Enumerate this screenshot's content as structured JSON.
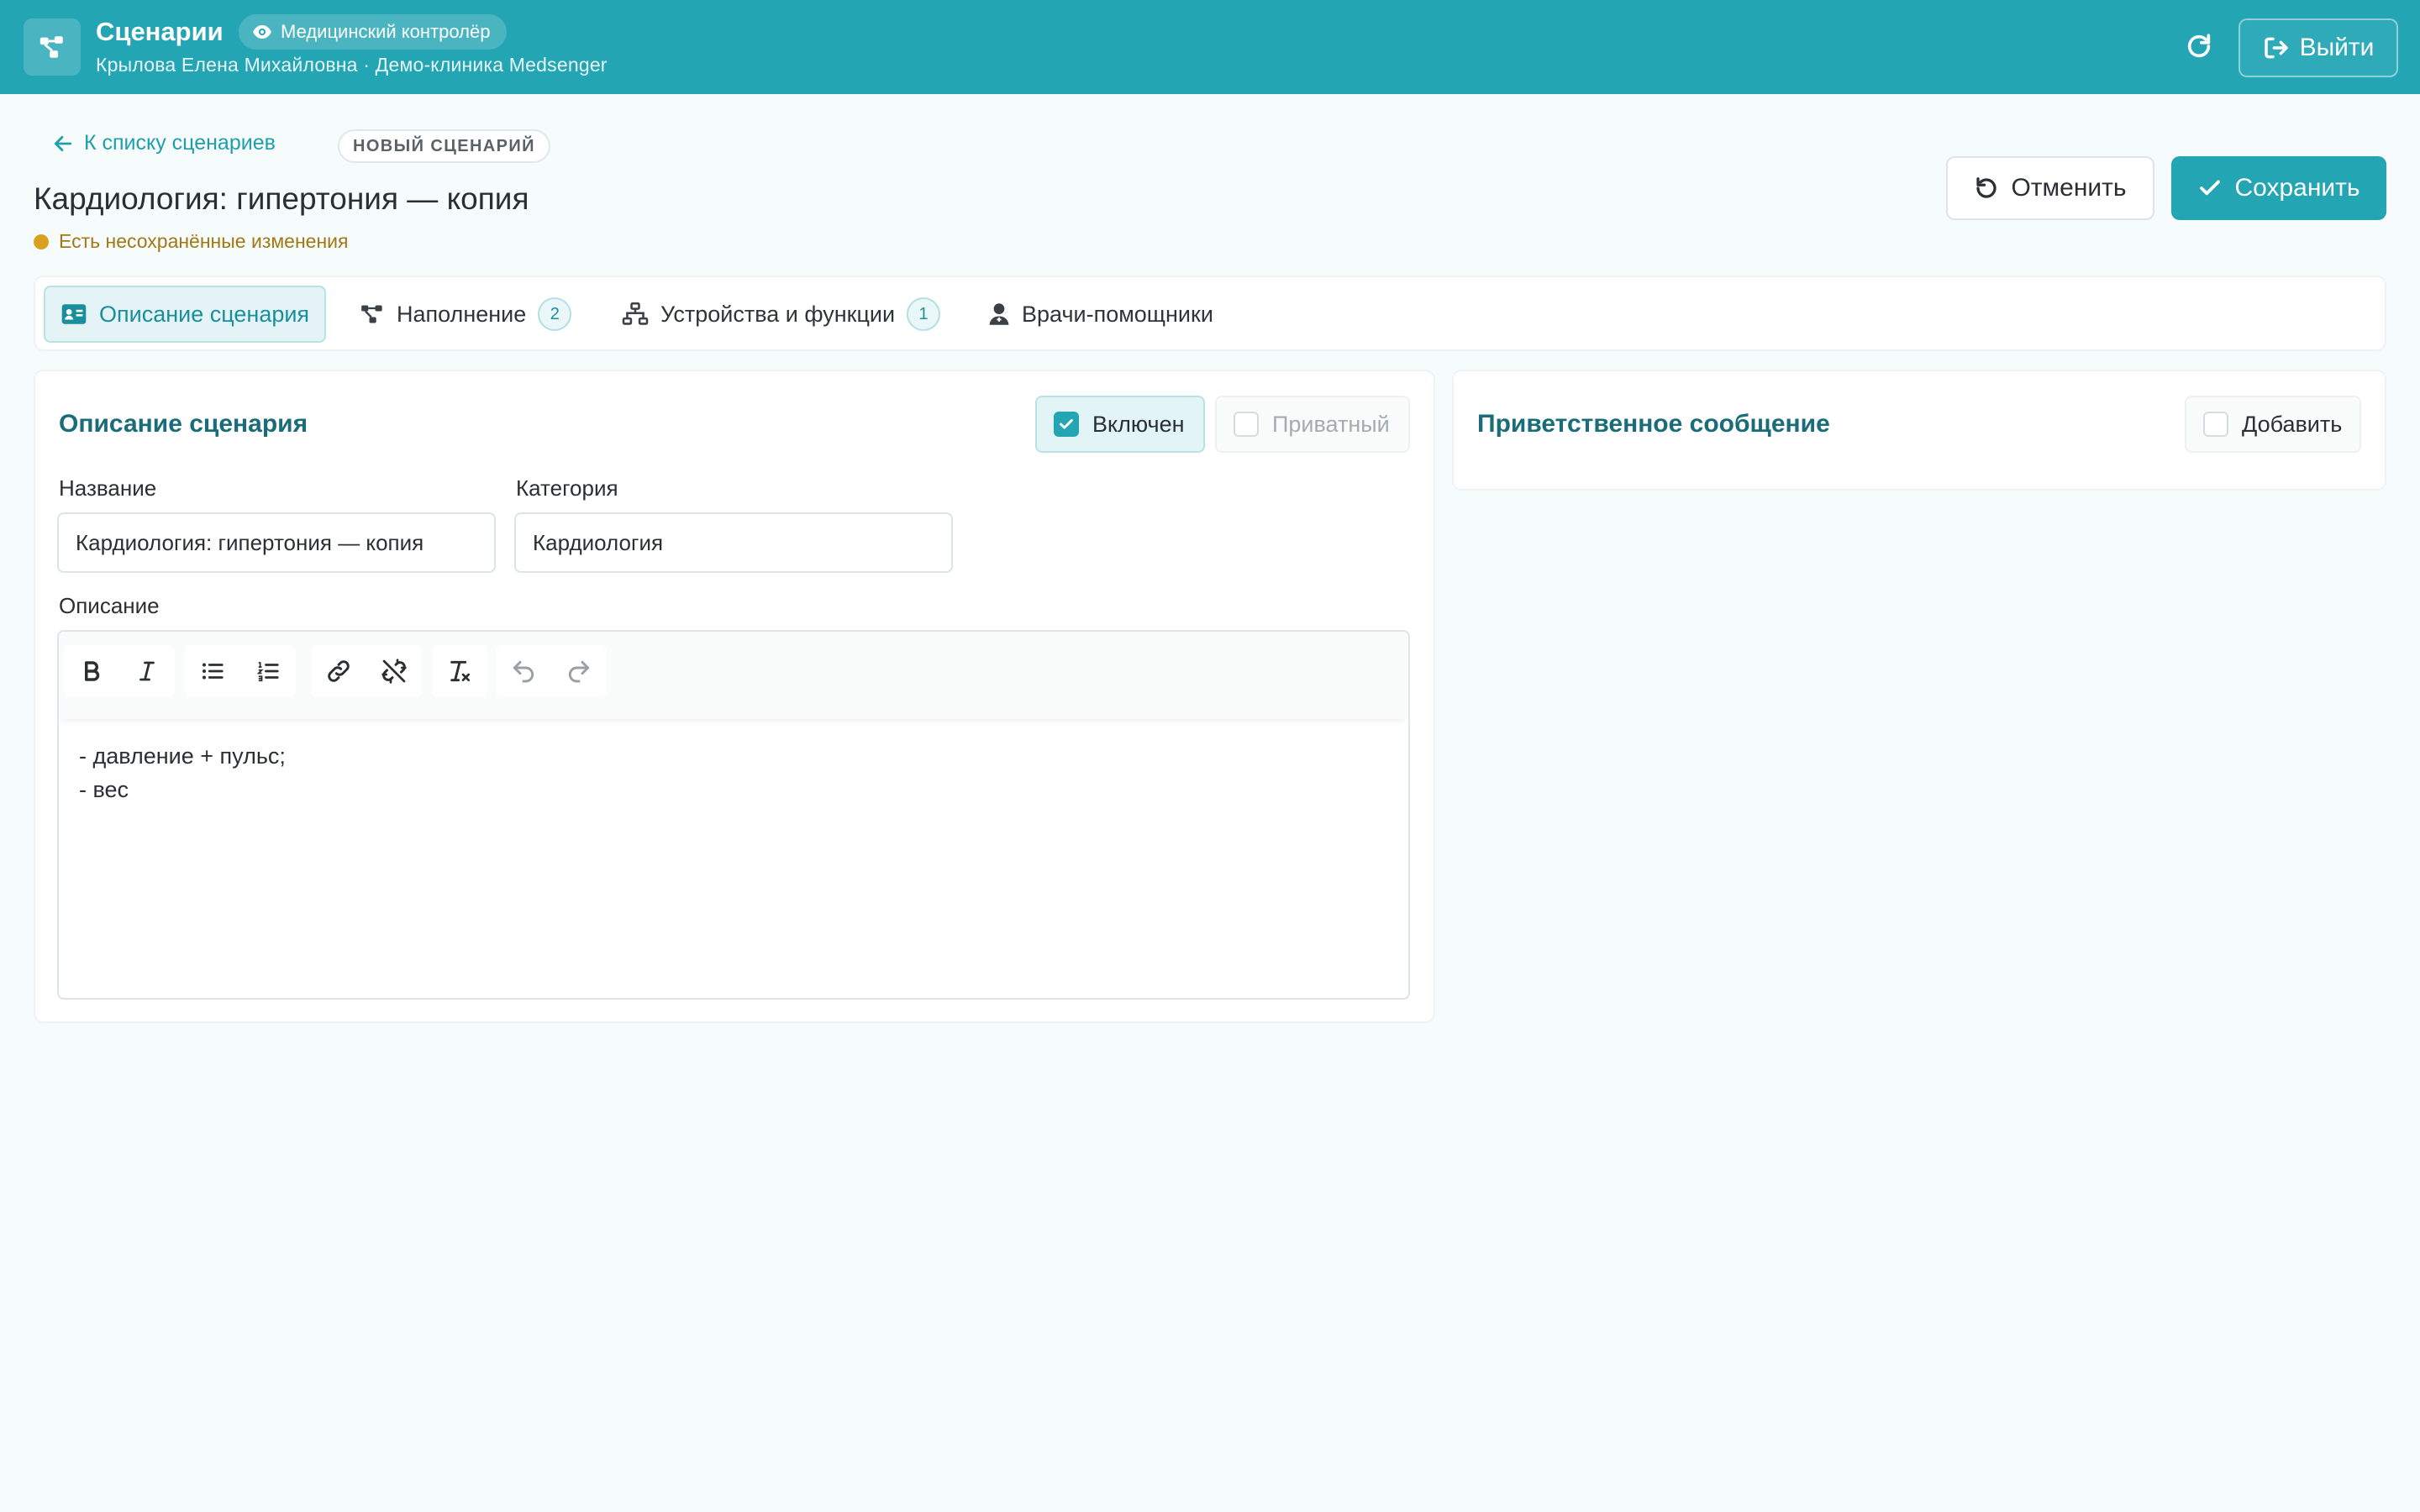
{
  "header": {
    "app_title": "Сценарии",
    "role_badge": "Медицинский контролёр",
    "user_line": "Крылова Елена Михайловна · Демо-клиника Medsenger",
    "logout_label": "Выйти"
  },
  "page": {
    "back_label": "К списку сценариев",
    "status_badge": "НОВЫЙ СЦЕНАРИЙ",
    "title": "Кардиология: гипертония — копия",
    "unsaved_notice": "Есть несохранённые изменения",
    "cancel_label": "Отменить",
    "save_label": "Сохранить"
  },
  "tabs": [
    {
      "label": "Описание сценария",
      "icon": "id-card-icon",
      "count": null,
      "active": true
    },
    {
      "label": "Наполнение",
      "icon": "diagram-icon",
      "count": "2",
      "active": false
    },
    {
      "label": "Устройства и функции",
      "icon": "sitemap-icon",
      "count": "1",
      "active": false
    },
    {
      "label": "Врачи-помощники",
      "icon": "user-doctor-icon",
      "count": null,
      "active": false
    }
  ],
  "description_card": {
    "title": "Описание сценария",
    "enabled_label": "Включен",
    "enabled_checked": true,
    "private_label": "Приватный",
    "private_checked": false,
    "name_label": "Название",
    "name_value": "Кардиология: гипертония — копия",
    "category_label": "Категория",
    "category_value": "Кардиология",
    "description_label": "Описание",
    "description_lines": [
      "- давление + пульс;",
      "- вес"
    ]
  },
  "welcome_card": {
    "title": "Приветственное сообщение",
    "add_label": "Добавить",
    "add_checked": false
  },
  "colors": {
    "brand": "#23a5b4",
    "warning_dot": "#d9a11e",
    "heading": "#1a6c78"
  }
}
